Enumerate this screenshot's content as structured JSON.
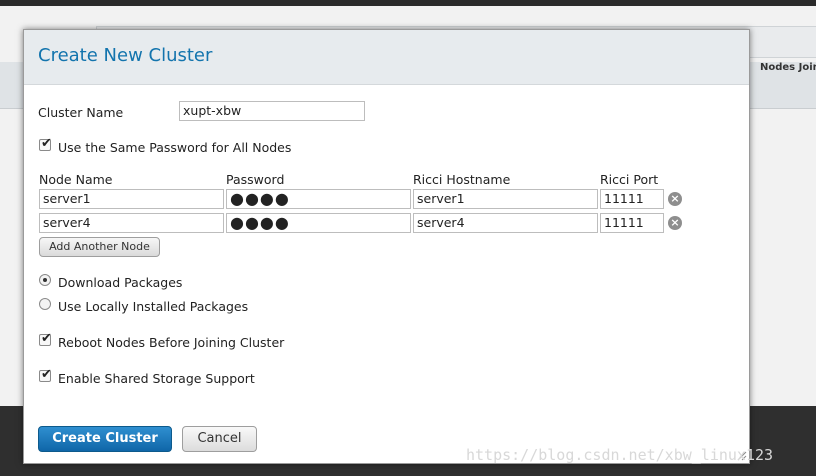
{
  "background": {
    "column_header": "Nodes Join",
    "watermark": "https://blog.csdn.net/xbw_linux123"
  },
  "dialog": {
    "title": "Create New Cluster",
    "cluster_name_label": "Cluster Name",
    "cluster_name_value": "xupt-xbw",
    "same_password": {
      "label": "Use the Same Password for All Nodes",
      "checked": true
    },
    "table": {
      "headers": [
        "Node Name",
        "Password",
        "Ricci Hostname",
        "Ricci Port"
      ],
      "rows": [
        {
          "node_name": "server1",
          "password": "●●●●",
          "ricci_hostname": "server1",
          "ricci_port": "11111"
        },
        {
          "node_name": "server4",
          "password": "●●●●",
          "ricci_hostname": "server4",
          "ricci_port": "11111"
        }
      ]
    },
    "add_node_label": "Add Another Node",
    "packages": {
      "download": {
        "label": "Download Packages",
        "selected": true
      },
      "local": {
        "label": "Use Locally Installed Packages",
        "selected": false
      }
    },
    "reboot": {
      "label": "Reboot Nodes Before Joining Cluster",
      "checked": true
    },
    "shared_storage": {
      "label": "Enable Shared Storage Support",
      "checked": true
    },
    "create_label": "Create Cluster",
    "cancel_label": "Cancel"
  },
  "colors": {
    "title": "#1374ad",
    "primary_button": "#1a74b8"
  }
}
